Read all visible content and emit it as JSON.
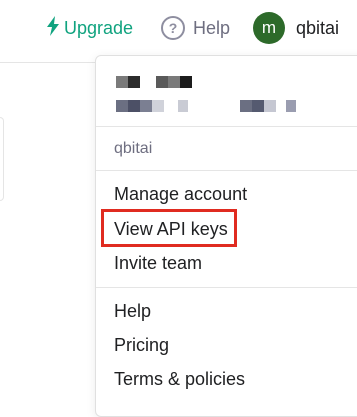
{
  "topbar": {
    "upgrade_label": "Upgrade",
    "help_label": "Help",
    "help_icon_glyph": "?",
    "avatar_initial": "m",
    "username": "qbitai"
  },
  "menu": {
    "org_name": "qbitai",
    "account_items": [
      "Manage account",
      "View API keys",
      "Invite team"
    ],
    "support_items": [
      "Help",
      "Pricing",
      "Terms & policies"
    ]
  },
  "colors": {
    "accent": "#10a37f",
    "avatar": "#2d6a2a",
    "highlight": "#e02b20"
  }
}
